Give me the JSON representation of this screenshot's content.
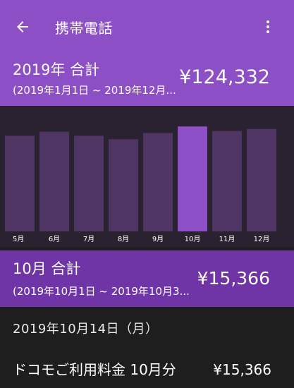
{
  "appbar": {
    "title": "携帯電話",
    "back_icon": "arrow-left-icon",
    "menu_icon": "more-vert-icon"
  },
  "year_summary": {
    "label": "2019年 合計",
    "range": "(2019年1月1日 ~ 2019年12月...",
    "total": "¥124,332"
  },
  "chart_data": {
    "type": "bar",
    "categories": [
      "5月",
      "6月",
      "7月",
      "8月",
      "9月",
      "10月",
      "11月",
      "12月"
    ],
    "values": [
      14000,
      14600,
      14000,
      13500,
      14400,
      15366,
      14700,
      15000
    ],
    "ylim": [
      0,
      15700
    ],
    "selected_index": 5,
    "colors": {
      "bar": "#4f3563",
      "bar_selected": "#8c4fc6",
      "background": "#2a2131"
    }
  },
  "month_summary": {
    "label": "10月 合計",
    "range": "(2019年10月1日 ~ 2019年10月3...",
    "total": "¥15,366"
  },
  "date_header": "2019年10月14日（月）",
  "item": {
    "label": "ドコモご利用料金 10月分",
    "amount": "¥15,366"
  },
  "colors": {
    "accent": "#8c4fc6",
    "accent_dark": "#6f35a6",
    "background": "#1e1e1e"
  }
}
